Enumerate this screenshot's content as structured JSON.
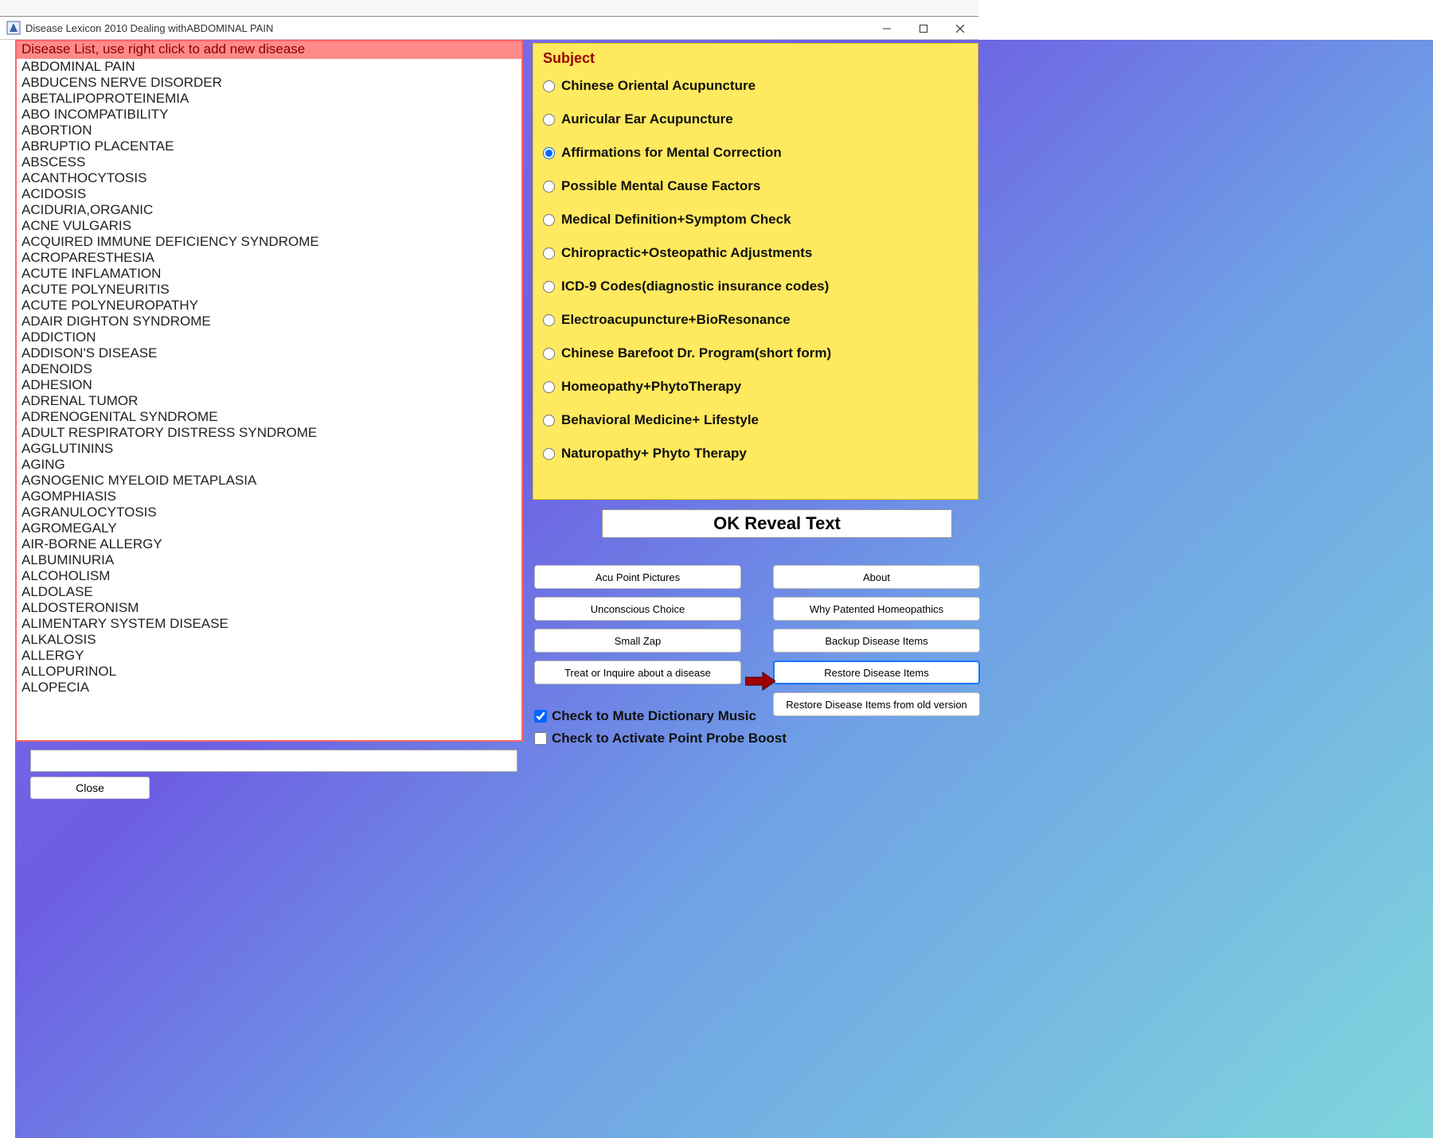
{
  "window": {
    "title": "Disease Lexicon 2010 Dealing withABDOMINAL PAIN"
  },
  "left": {
    "header": "Disease List, use right click to add new disease",
    "items": [
      "ABDOMINAL PAIN",
      "ABDUCENS NERVE DISORDER",
      "ABETALIPOPROTEINEMIA",
      "ABO INCOMPATIBILITY",
      "ABORTION",
      "ABRUPTIO PLACENTAE",
      "ABSCESS",
      "ACANTHOCYTOSIS",
      "ACIDOSIS",
      "ACIDURIA,ORGANIC",
      "ACNE VULGARIS",
      "ACQUIRED IMMUNE DEFICIENCY SYNDROME",
      "ACROPARESTHESIA",
      "ACUTE INFLAMATION",
      "ACUTE POLYNEURITIS",
      "ACUTE POLYNEUROPATHY",
      "ADAIR DIGHTON SYNDROME",
      "ADDICTION",
      "ADDISON'S DISEASE",
      "ADENOIDS",
      "ADHESION",
      "ADRENAL TUMOR",
      "ADRENOGENITAL SYNDROME",
      "ADULT RESPIRATORY DISTRESS SYNDROME",
      "AGGLUTININS",
      "AGING",
      "AGNOGENIC MYELOID METAPLASIA",
      "AGOMPHIASIS",
      "AGRANULOCYTOSIS",
      "AGROMEGALY",
      "AIR-BORNE ALLERGY",
      "ALBUMINURIA",
      "ALCOHOLISM",
      "ALDOLASE",
      "ALDOSTERONISM",
      "ALIMENTARY SYSTEM DISEASE",
      "ALKALOSIS",
      "ALLERGY",
      "ALLOPURINOL",
      "ALOPECIA"
    ],
    "close_label": "Close",
    "input_value": ""
  },
  "right": {
    "subject_title": "Subject",
    "subjects": [
      "Chinese Oriental Acupuncture",
      "Auricular Ear Acupuncture",
      "Affirmations for Mental Correction",
      "Possible Mental Cause Factors",
      "Medical Definition+Symptom Check",
      "Chiropractic+Osteopathic Adjustments",
      "ICD-9 Codes(diagnostic insurance codes)",
      "Electroacupuncture+BioResonance",
      "Chinese Barefoot Dr. Program(short form)",
      "Homeopathy+PhytoTherapy",
      "Behavioral Medicine+ Lifestyle",
      "Naturopathy+ Phyto Therapy"
    ],
    "selected_subject_index": 2,
    "reveal_label": "OK Reveal Text",
    "buttons": {
      "b0": "Acu Point Pictures",
      "b1": "About",
      "b2": "Unconscious Choice",
      "b3": "Why Patented Homeopathics",
      "b4": "Small Zap",
      "b5": "Backup Disease Items",
      "b6": "Treat or Inquire about a disease",
      "b7": "Restore Disease Items",
      "b8": "Restore Disease Items from old version"
    },
    "checks": {
      "mute": {
        "label": "Check to Mute Dictionary Music",
        "checked": true
      },
      "probe": {
        "label": "Check to Activate Point Probe Boost",
        "checked": false
      }
    }
  }
}
